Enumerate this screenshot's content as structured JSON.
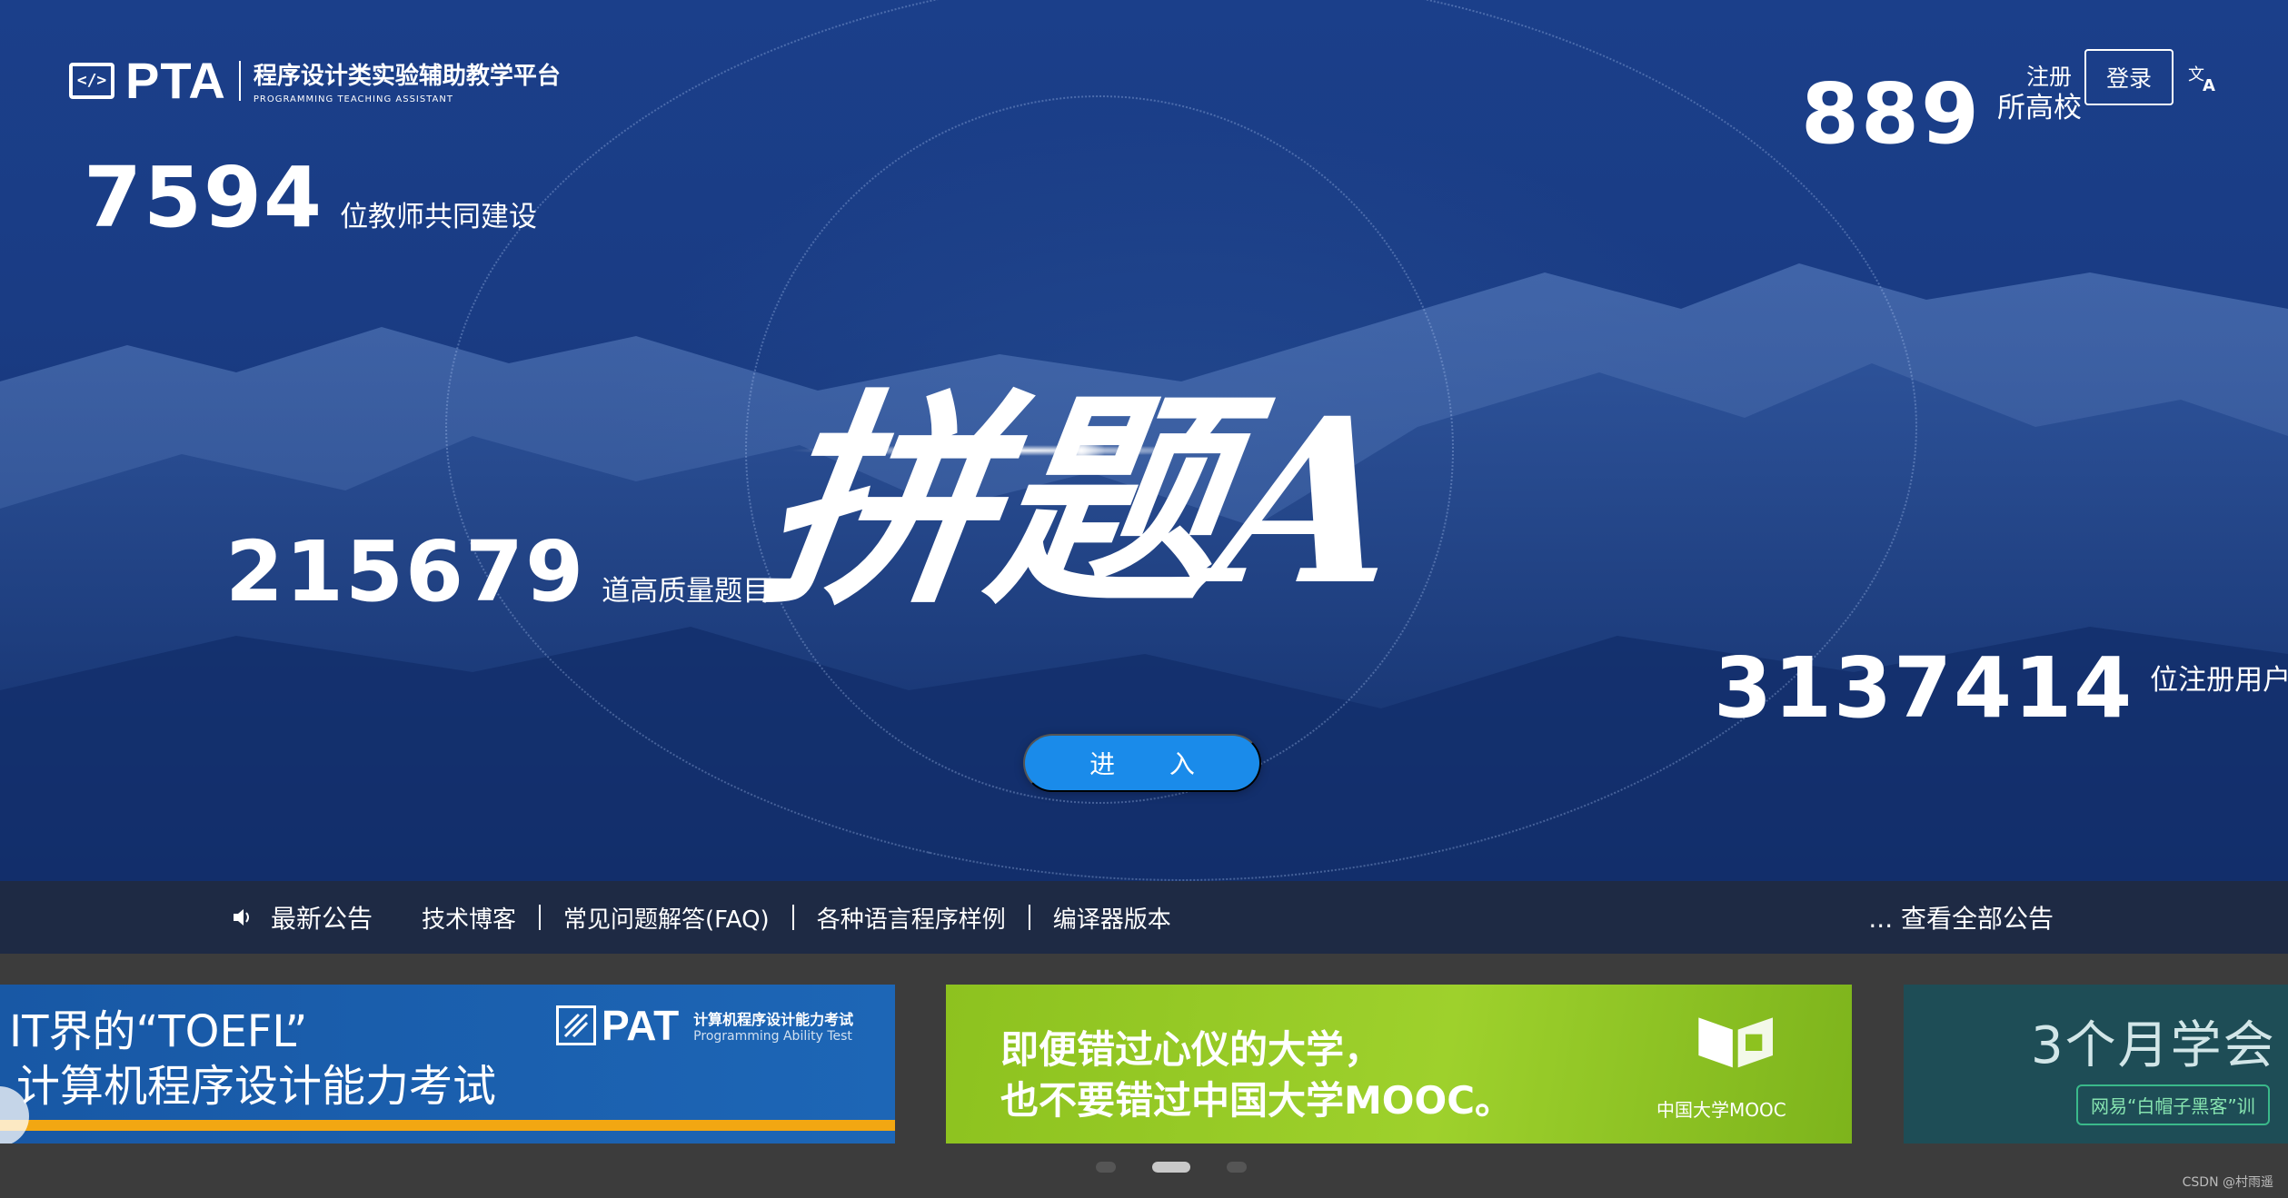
{
  "header": {
    "logo_text": "PTA",
    "platform_name": "程序设计类实验辅助教学平台",
    "platform_name_en": "PROGRAMMING TEACHING ASSISTANT",
    "register_label": "注册",
    "login_label": "登录"
  },
  "stats": {
    "teachers": {
      "value": "7594",
      "label": "位教师共同建设"
    },
    "schools": {
      "value": "889",
      "label": "所高校"
    },
    "problems": {
      "value": "215679",
      "label": "道高质量题目"
    },
    "users": {
      "value": "3137414",
      "label": "位注册用户共同拼题"
    }
  },
  "slogan": "拼题A",
  "enter_label": "进 入",
  "notice": {
    "title": "最新公告",
    "links": [
      "技术博客",
      "常见问题解答(FAQ)",
      "各种语言程序样例",
      "编译器版本"
    ],
    "view_all": "... 查看全部公告"
  },
  "banners": {
    "pat": {
      "line1": "IT界的“TOEFL”",
      "line2": "计算机程序设计能力考试",
      "logo": "PAT",
      "logo_cn": "计算机程序设计能力考试",
      "logo_en": "Programming Ability Test"
    },
    "mooc": {
      "line1": "即便错过心仪的大学，",
      "line2": "也不要错过中国大学MOOC。",
      "logo_label": "中国大学MOOC"
    },
    "hacker": {
      "line1": "3个月学会",
      "tag": "网易“白帽子黑客”训"
    }
  },
  "carousel": {
    "count": 3,
    "active_index": 1
  },
  "watermark": "CSDN @村雨遥"
}
